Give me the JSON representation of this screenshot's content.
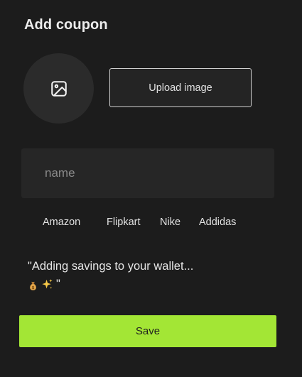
{
  "header": {
    "title": "Add coupon"
  },
  "image_picker": {
    "icon": "image-icon",
    "upload_label": "Upload image"
  },
  "form": {
    "name_placeholder": "name",
    "name_value": ""
  },
  "suggestions": [
    {
      "label": "Amazon"
    },
    {
      "label": "Flipkart"
    },
    {
      "label": "Nike"
    },
    {
      "label": "Addidas"
    }
  ],
  "message": {
    "line1": "\"Adding savings to your wallet...",
    "emojis": [
      "money-bag-icon",
      "sparkles-icon"
    ],
    "closing_quote": "\""
  },
  "actions": {
    "save_label": "Save"
  },
  "colors": {
    "background": "#1c1c1c",
    "surface": "#262626",
    "accent": "#a3e635"
  }
}
